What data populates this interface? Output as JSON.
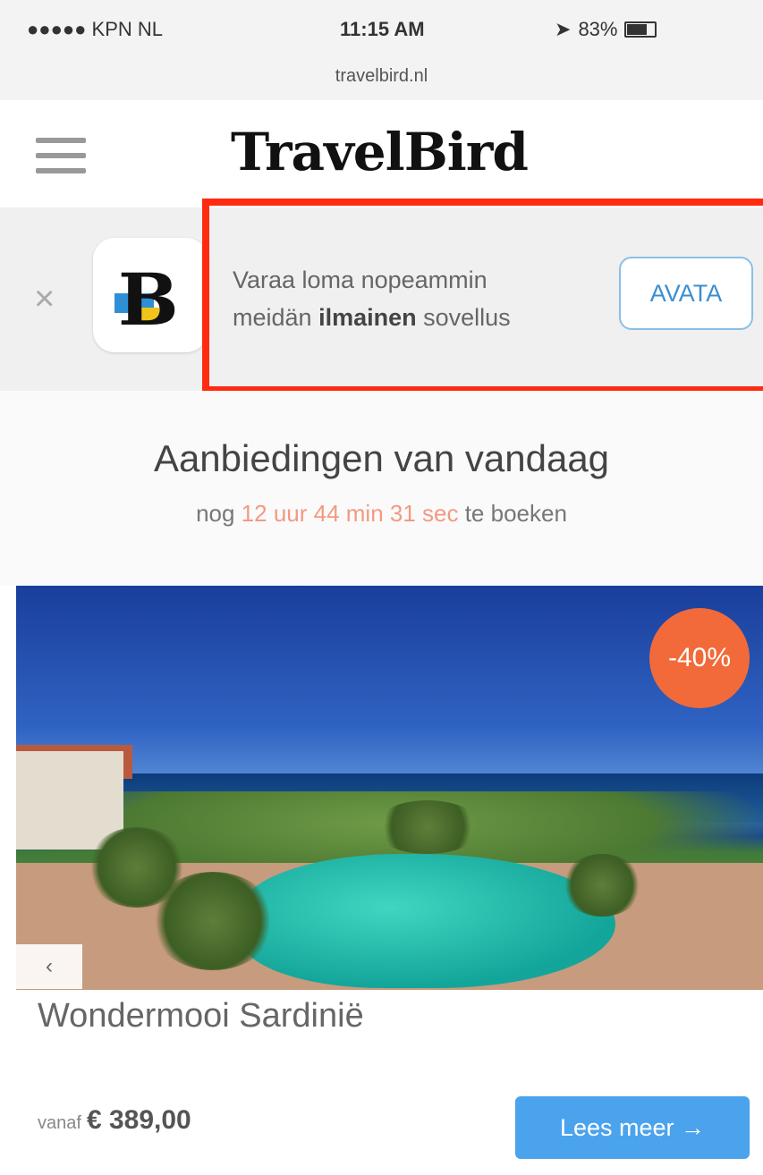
{
  "status_bar": {
    "carrier": "●●●●● KPN NL",
    "time": "11:15 AM",
    "battery": "83%",
    "battery_level": 0.83,
    "url": "travelbird.nl"
  },
  "header": {
    "logo_part1": "Travel",
    "logo_part2": "Bird"
  },
  "smart_banner": {
    "close_icon": "×",
    "text_line1": "Varaa loma nopeammin",
    "text_line2_pre": "meidän ",
    "text_line2_bold": "ilmainen",
    "text_line2_post": " sovellus",
    "open_button_label": "AVATA"
  },
  "offers": {
    "title": "Aanbiedingen van vandaag",
    "sub_pre": "nog ",
    "countdown": "12 uur 44 min 31 sec",
    "sub_post": " te boeken"
  },
  "deal": {
    "discount_badge": "-40%",
    "prev_arrow": "‹",
    "title": "Wondermooi Sardinië",
    "price_from": "vanaf",
    "price_value": "€ 389,00",
    "more_button_label": "Lees meer →"
  },
  "colors": {
    "accent_blue": "#4aa3ec",
    "countdown": "#f29a82",
    "badge": "#f26a3a",
    "highlight_red": "#ff2a10"
  }
}
